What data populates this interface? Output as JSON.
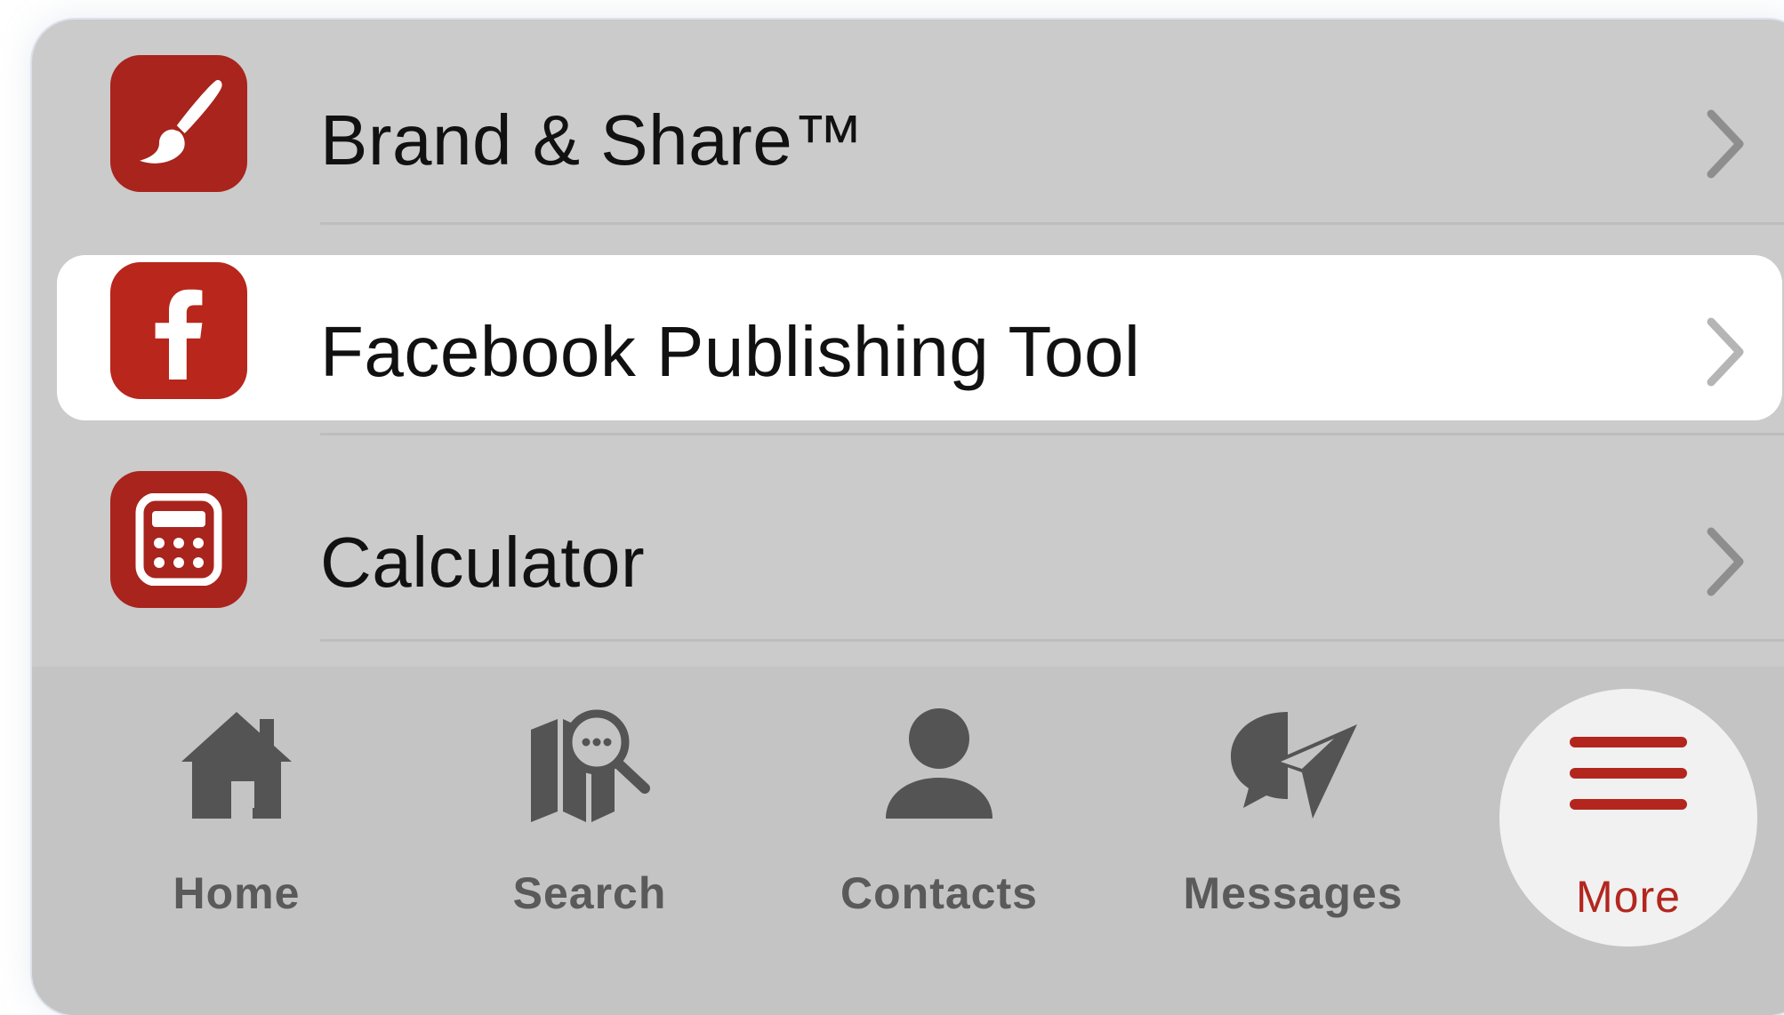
{
  "menu": {
    "items": [
      {
        "label": "Brand & Share™",
        "icon": "paintbrush-icon"
      },
      {
        "label": "Facebook Publishing Tool",
        "icon": "facebook-icon"
      },
      {
        "label": "Calculator",
        "icon": "calculator-icon"
      }
    ]
  },
  "tabbar": {
    "tabs": [
      {
        "label": "Home",
        "icon": "home-icon"
      },
      {
        "label": "Search",
        "icon": "map-search-icon"
      },
      {
        "label": "Contacts",
        "icon": "person-icon"
      },
      {
        "label": "Messages",
        "icon": "chat-send-icon"
      },
      {
        "label": "More",
        "icon": "hamburger-menu-icon"
      }
    ],
    "active": "More"
  },
  "colors": {
    "accent": "#b3261e",
    "icon_tile": "#a8241c",
    "panel_bg": "#cbcbcb",
    "highlight_row": "#ffffff",
    "tab_icon": "#545454"
  }
}
